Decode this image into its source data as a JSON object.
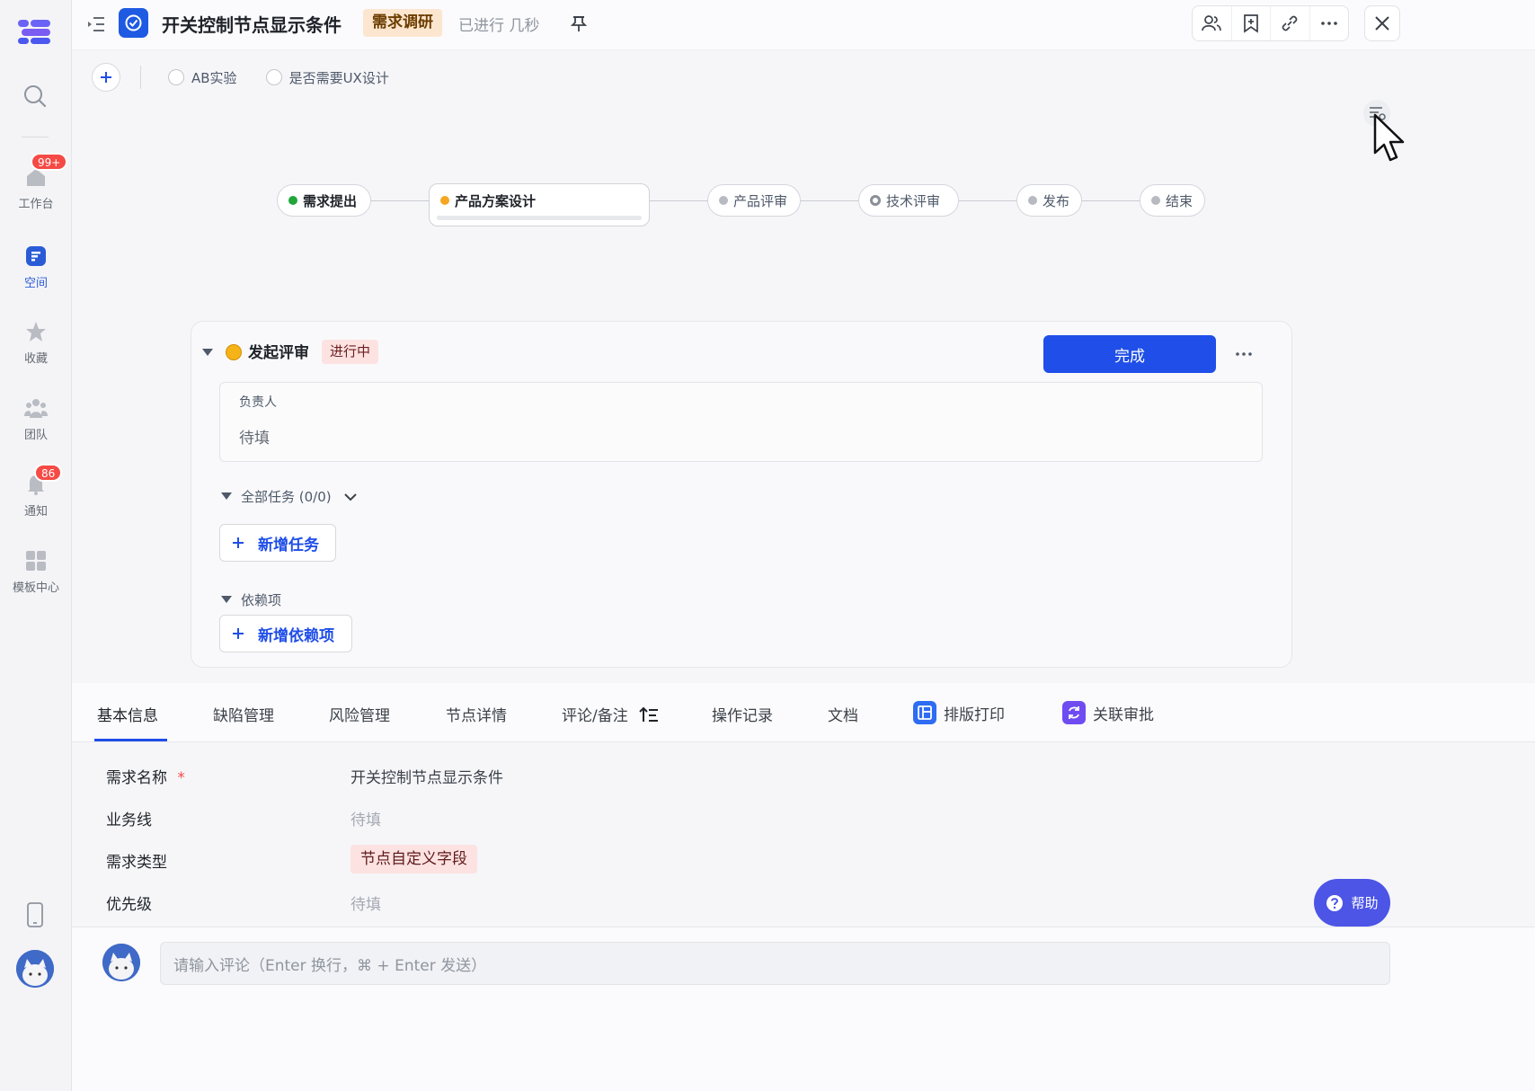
{
  "sidebar": {
    "items": [
      {
        "label": "工作台",
        "badge": "99+"
      },
      {
        "label": "空间"
      },
      {
        "label": "收藏"
      },
      {
        "label": "团队"
      },
      {
        "label": "通知",
        "badge": "86"
      },
      {
        "label": "模板中心"
      }
    ]
  },
  "header": {
    "title": "开关控制节点显示条件",
    "status": "需求调研",
    "elapsed": "已进行 几秒"
  },
  "options": {
    "ab_test": "AB实验",
    "ux_design": "是否需要UX设计"
  },
  "flow": {
    "nodes": [
      {
        "label": "需求提出",
        "state": "done",
        "color": "#22a63b"
      },
      {
        "label": "产品方案设计",
        "state": "active",
        "color": "#f5a623"
      },
      {
        "label": "产品评审",
        "state": "todo",
        "color": "#b7bac1"
      },
      {
        "label": "技术评审",
        "state": "todo",
        "color": "#8a8f98"
      },
      {
        "label": "发布",
        "state": "todo",
        "color": "#b7bac1"
      },
      {
        "label": "结束",
        "state": "todo",
        "color": "#b7bac1"
      }
    ]
  },
  "card": {
    "title": "发起评审",
    "state": "进行中",
    "done_label": "完成",
    "owner_label": "负责人",
    "owner_value": "待填",
    "tasks_label": "全部任务 (0/0)",
    "add_task": "新增任务",
    "deps_label": "依赖项",
    "add_dep": "新增依赖项"
  },
  "tabs": [
    {
      "label": "基本信息"
    },
    {
      "label": "缺陷管理"
    },
    {
      "label": "风险管理"
    },
    {
      "label": "节点详情"
    },
    {
      "label": "评论/备注"
    },
    {
      "label": "操作记录"
    },
    {
      "label": "文档"
    },
    {
      "label": "排版打印"
    },
    {
      "label": "关联审批"
    }
  ],
  "fields": [
    {
      "label": "需求名称",
      "required": "*",
      "value": "开关控制节点显示条件"
    },
    {
      "label": "业务线",
      "value": "待填"
    },
    {
      "label": "需求类型",
      "value": "节点自定义字段"
    },
    {
      "label": "优先级",
      "value": "待填"
    }
  ],
  "help_label": "帮助",
  "comment_placeholder": "请输入评论（Enter 换行，⌘ + Enter 发送）",
  "colors": {
    "accent": "#1f4ee8",
    "help": "#4d55e6"
  }
}
